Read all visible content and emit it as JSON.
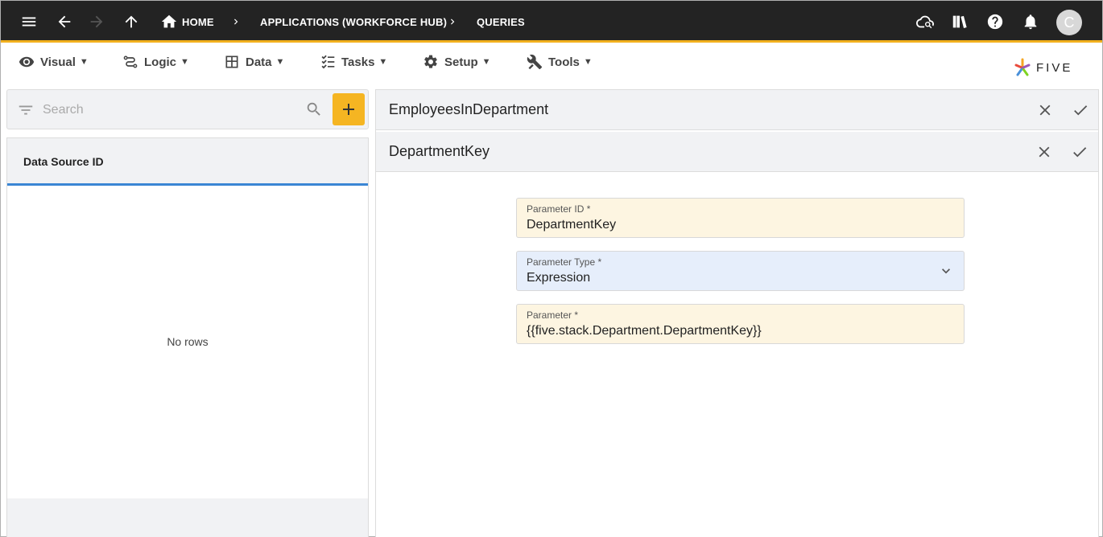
{
  "topbar": {
    "breadcrumbs": {
      "home": "HOME",
      "applications": "APPLICATIONS (WORKFORCE HUB)",
      "queries": "QUERIES"
    },
    "avatar_initial": "C",
    "accent_color": "#f2b01e"
  },
  "menu": {
    "visual": "Visual",
    "logic": "Logic",
    "data": "Data",
    "tasks": "Tasks",
    "setup": "Setup",
    "tools": "Tools",
    "caret": "▼"
  },
  "logo": {
    "text": "FIVE"
  },
  "list": {
    "search_placeholder": "Search",
    "column_header": "Data Source ID",
    "empty_text": "No rows"
  },
  "forms": {
    "parent_title": "EmployeesInDepartment",
    "child_title": "DepartmentKey",
    "fields": [
      {
        "label": "Parameter ID *",
        "value": "DepartmentKey"
      },
      {
        "label": "Parameter Type *",
        "value": "Expression"
      },
      {
        "label": "Parameter *",
        "value": "{{five.stack.Department.DepartmentKey}}"
      }
    ]
  },
  "colors": {
    "add_button": "#f5b522",
    "header_underline": "#3a86d4",
    "required_field_bg": "#fdf5e1",
    "select_field_bg": "#e6eefb"
  }
}
